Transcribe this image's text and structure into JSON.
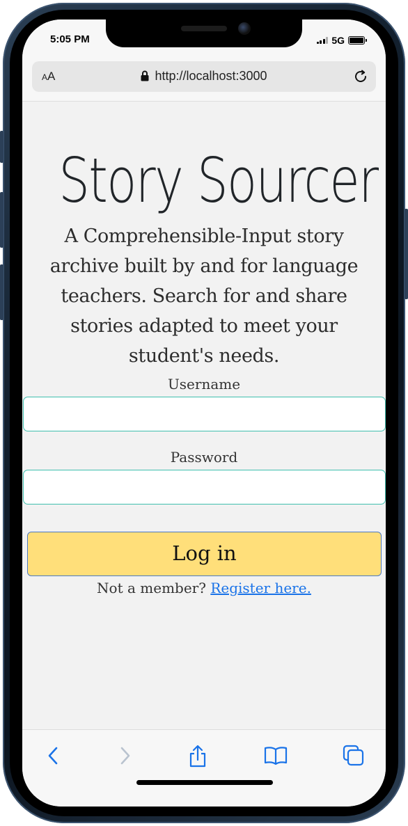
{
  "status": {
    "time": "5:05 PM",
    "network": "5G"
  },
  "browser": {
    "text_size_label_small": "A",
    "text_size_label_large": "A",
    "url": "http://localhost:3000"
  },
  "page": {
    "title": "Story Sourcer",
    "tagline": "A Comprehensible-Input story archive built by and for language teachers. Search for and share stories adapted to meet your student's needs.",
    "username_label": "Username",
    "username_value": "",
    "password_label": "Password",
    "password_value": "",
    "login_label": "Log in",
    "register_prompt": "Not a member?",
    "register_link": "Register here."
  },
  "toolbar": {
    "icons": [
      "back-icon",
      "forward-icon",
      "share-icon",
      "bookmarks-icon",
      "tabs-icon"
    ]
  },
  "colors": {
    "input_border": "#3fbfae",
    "button_bg": "#ffdf7a",
    "button_border": "#4a78c2",
    "link": "#1a73e8",
    "toolbar_icon": "#1a73e8"
  }
}
